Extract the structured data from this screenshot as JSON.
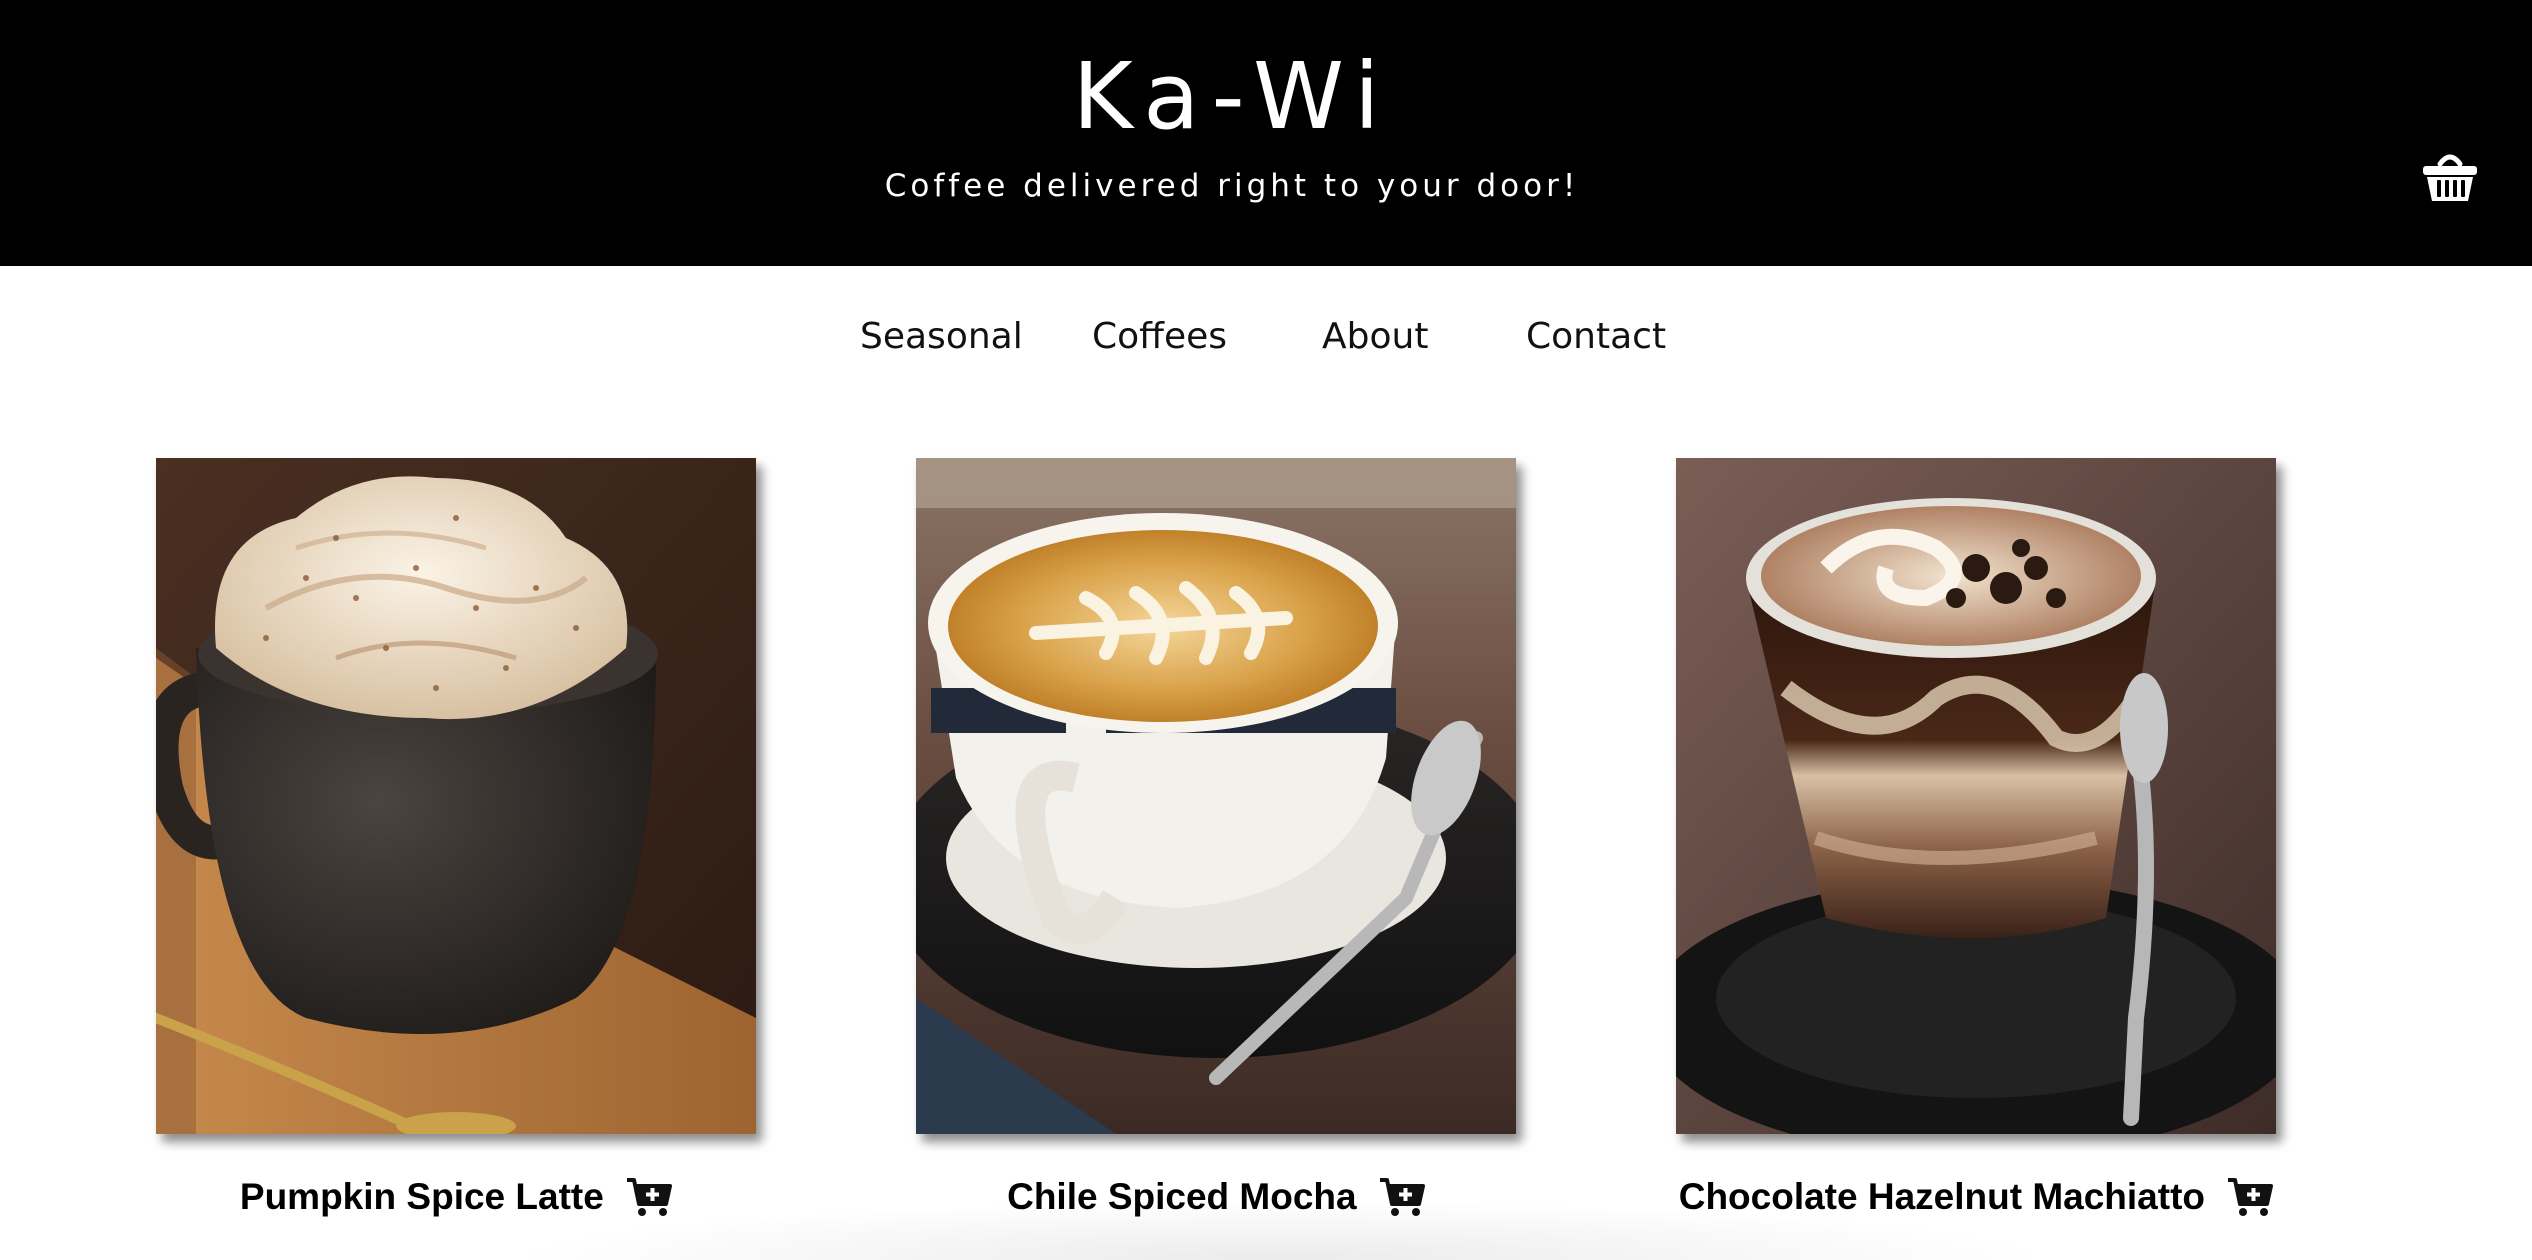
{
  "header": {
    "site_title": "Ka-Wi",
    "tagline": "Coffee delivered right to your door!",
    "cart_icon": "shopping-basket-icon",
    "background_color": "#000000",
    "text_color": "#ffffff"
  },
  "nav": {
    "items": [
      {
        "label": "Seasonal"
      },
      {
        "label": "Coffees"
      },
      {
        "label": "About"
      },
      {
        "label": "Contact"
      }
    ]
  },
  "products": [
    {
      "name": "Pumpkin Spice Latte",
      "image": "pumpkin-spice-latte-photo",
      "cart_icon": "add-to-cart-icon"
    },
    {
      "name": "Chile Spiced Mocha",
      "image": "chile-spiced-mocha-photo",
      "cart_icon": "add-to-cart-icon"
    },
    {
      "name": "Chocolate Hazelnut Machiatto",
      "image": "chocolate-hazelnut-machiatto-photo",
      "cart_icon": "add-to-cart-icon"
    }
  ]
}
